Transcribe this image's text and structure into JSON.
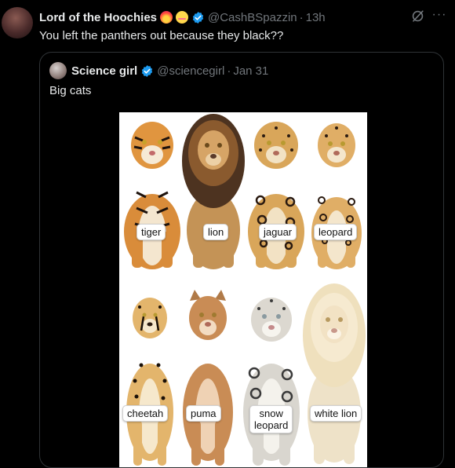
{
  "tweet": {
    "author_name": "Lord of the Hoochies",
    "handle": "@CashBSpazzin",
    "time": "13h",
    "text": "You left the panthers out because they black??",
    "emojis": [
      "fire-heart-emoji",
      "smiling-blush-emoji"
    ]
  },
  "quoted_tweet": {
    "author_name": "Science girl",
    "handle": "@sciencegirl",
    "date": "Jan 31",
    "text": "Big cats"
  },
  "media": {
    "labels": [
      "tiger",
      "lion",
      "jaguar",
      "leopard",
      "cheetah",
      "puma",
      "snow\nleopard",
      "white lion"
    ]
  },
  "colors": {
    "background": "#000000",
    "text_primary": "#e7e9ea",
    "text_secondary": "#71767b",
    "verified": "#1d9bf0",
    "border": "#2f3336"
  },
  "icons": [
    "verified-badge-icon",
    "grok-icon",
    "more-icon"
  ]
}
